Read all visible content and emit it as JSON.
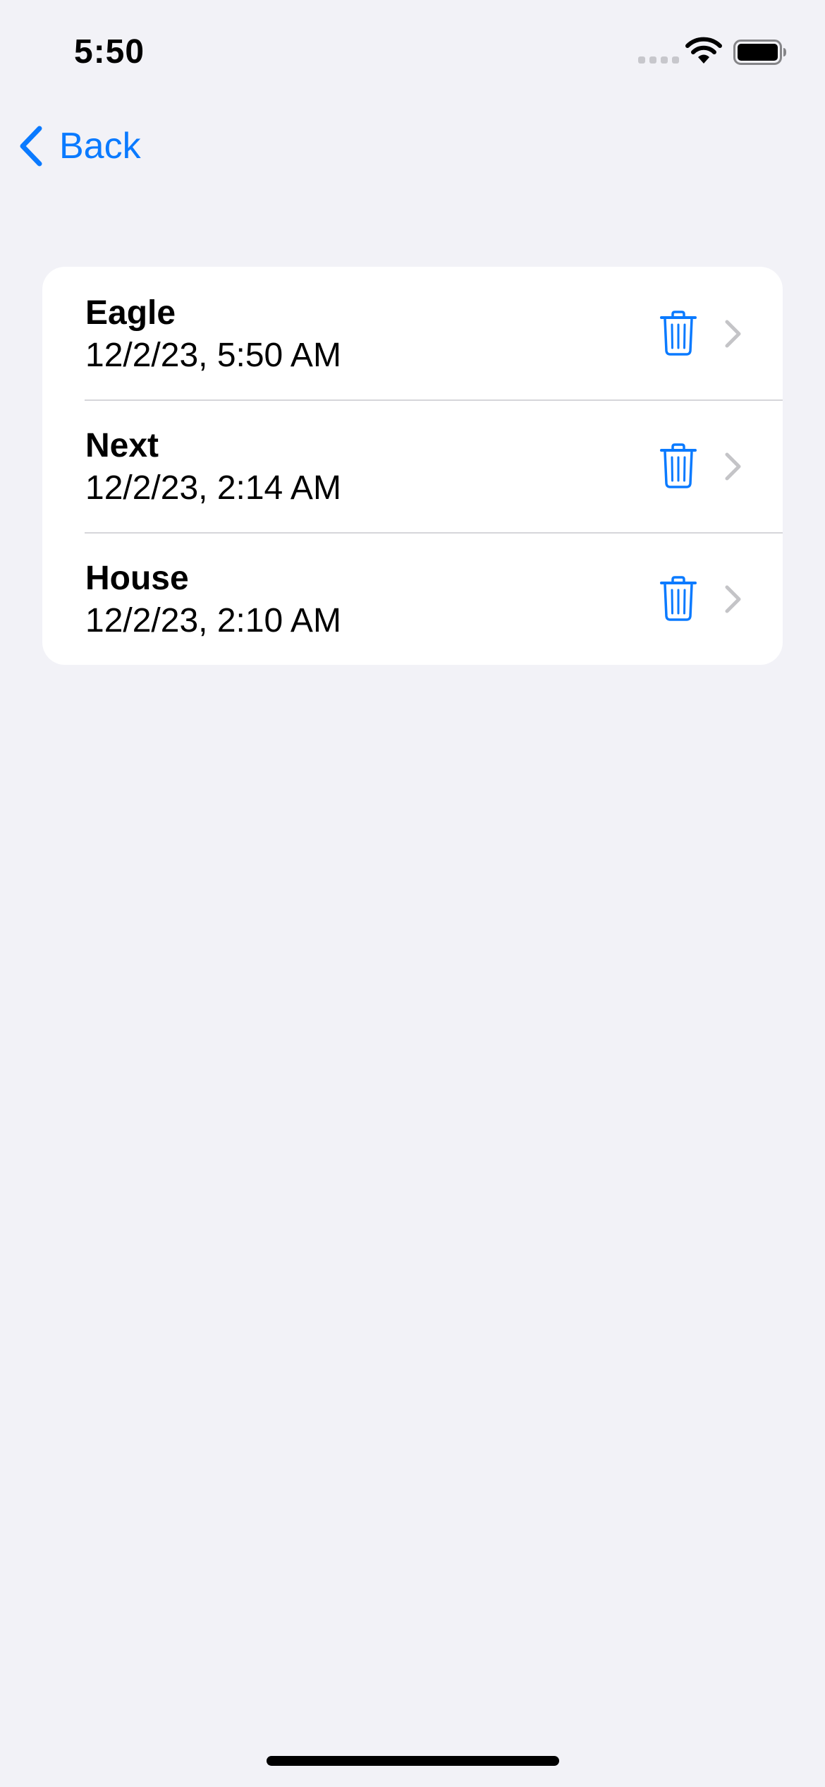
{
  "status_bar": {
    "time": "5:50",
    "icons": [
      "cellular-signal-icon",
      "wifi-icon",
      "battery-icon"
    ]
  },
  "nav": {
    "back_label": "Back",
    "back_icon": "chevron-left-icon"
  },
  "colors": {
    "accent": "#0A7AFF",
    "background": "#F2F2F7",
    "card": "#FFFFFF",
    "chevron": "#C4C4C7"
  },
  "list": {
    "items": [
      {
        "title": "Eagle",
        "subtitle": "12/2/23, 5:50 AM",
        "delete_icon": "trash-icon",
        "disclosure_icon": "chevron-right-icon"
      },
      {
        "title": "Next",
        "subtitle": "12/2/23, 2:14 AM",
        "delete_icon": "trash-icon",
        "disclosure_icon": "chevron-right-icon"
      },
      {
        "title": "House",
        "subtitle": "12/2/23, 2:10 AM",
        "delete_icon": "trash-icon",
        "disclosure_icon": "chevron-right-icon"
      }
    ]
  }
}
